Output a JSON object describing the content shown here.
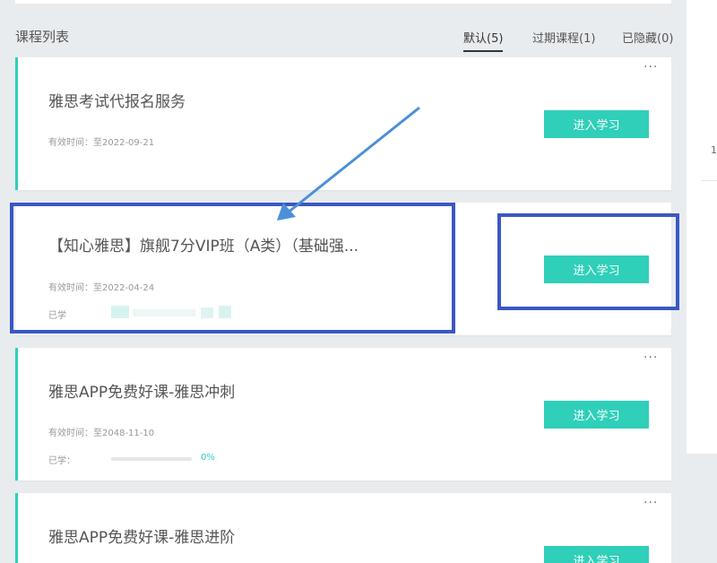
{
  "section": {
    "title": "课程列表"
  },
  "tabs": [
    {
      "label": "默认(5)",
      "active": true
    },
    {
      "label": "过期课程(1)",
      "active": false
    },
    {
      "label": "已隐藏(0)",
      "active": false
    }
  ],
  "side": {
    "number": "1"
  },
  "courses": [
    {
      "title": "雅思考试代报名服务",
      "validity": "有效时间：至2022-09-21",
      "button": "进入学习",
      "more": "···"
    },
    {
      "title": "【知心雅思】旗舰7分VIP班（A类）（基础强...",
      "validity": "有效时间：至2022-04-24",
      "learned_label": "已学",
      "button": "进入学习"
    },
    {
      "title": "雅思APP免费好课-雅思冲刺",
      "validity": "有效时间：至2048-11-10",
      "learned_label": "已学：",
      "progress": "0%",
      "progress_value": 0,
      "button": "进入学习",
      "more": "···"
    },
    {
      "title": "雅思APP免费好课-雅思进阶",
      "button": "进入学习",
      "more": "···"
    }
  ],
  "colors": {
    "accent": "#2fcfb9",
    "highlight": "#3b57c4",
    "arrow": "#4a90d9"
  }
}
